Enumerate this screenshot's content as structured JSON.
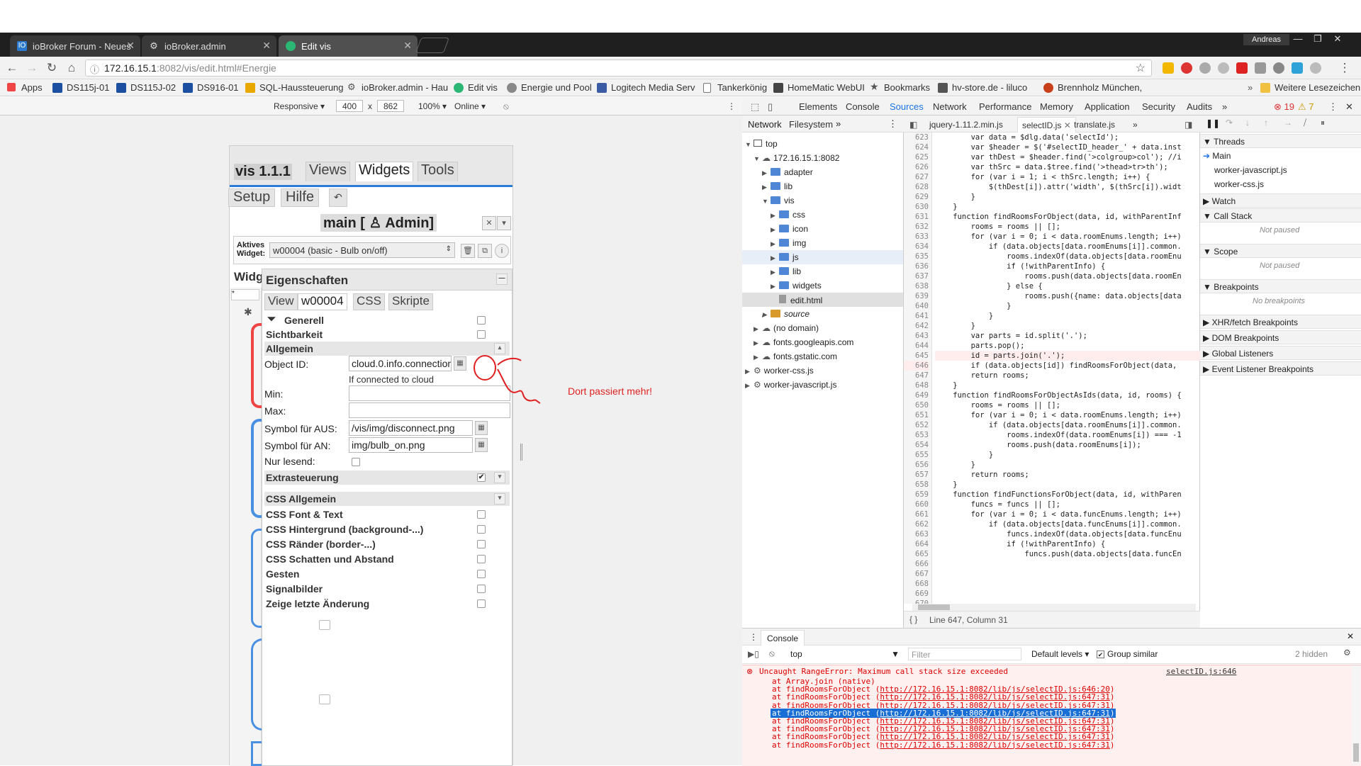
{
  "browser": {
    "tabs": [
      {
        "label": "ioBroker Forum - Neues"
      },
      {
        "label": "ioBroker.admin"
      },
      {
        "label": "Edit vis"
      }
    ],
    "user": "Andreas",
    "url_host": "172.16.15.1",
    "url_rest": ":8082/vis/edit.html#Energie",
    "bookmarks": [
      {
        "label": "Apps"
      },
      {
        "label": "DS115j-01"
      },
      {
        "label": "DS115J-02"
      },
      {
        "label": "DS916-01"
      },
      {
        "label": "SQL-Haussteuerung"
      },
      {
        "label": "ioBroker.admin - Hau"
      },
      {
        "label": "Edit vis"
      },
      {
        "label": "Energie und Pool"
      },
      {
        "label": "Logitech Media Serv"
      },
      {
        "label": "Tankerkönig"
      },
      {
        "label": "HomeMatic WebUI"
      },
      {
        "label": "Bookmarks"
      },
      {
        "label": "hv-store.de - liluco"
      },
      {
        "label": "Brennholz München,"
      }
    ],
    "other_bookmarks": "Weitere Lesezeichen"
  },
  "device_toolbar": {
    "mode": "Responsive",
    "width": "400",
    "times": "x",
    "height": "862",
    "zoom": "100%",
    "network": "Online"
  },
  "vis": {
    "title": "vis 1.1.1",
    "tabs": [
      "Views",
      "Widgets",
      "Tools"
    ],
    "buttons": [
      "Setup",
      "Hilfe",
      "↶"
    ],
    "main_label": "main [ ♙ Admin]",
    "active_widget_label": "Aktives Widget:",
    "active_widget_value": "w00004 (basic - Bulb on/off)",
    "widg_label": "Widg",
    "properties": {
      "header": "Eigenschaften",
      "tabs": [
        "View",
        "w00004",
        "CSS",
        "Skripte"
      ],
      "sections_top": [
        "Generell",
        "Sichtbarkeit",
        "Allgemein"
      ],
      "object_id_label": "Object ID:",
      "object_id_value": "cloud.0.info.connection",
      "object_id_hint": "If connected to cloud",
      "min_label": "Min:",
      "max_label": "Max:",
      "sym_aus_label": "Symbol für AUS:",
      "sym_aus_value": "/vis/img/disconnect.png",
      "sym_an_label": "Symbol für AN:",
      "sym_an_value": "img/bulb_on.png",
      "readonly_label": "Nur lesend:",
      "extra_label": "Extrasteuerung",
      "css_sections": [
        "CSS Allgemein",
        "CSS Font & Text",
        "CSS Hintergrund (background-...)",
        "CSS Ränder (border-...)",
        "CSS Schatten und Abstand",
        "Gesten",
        "Signalbilder",
        "Zeige letzte Änderung"
      ]
    }
  },
  "annotation": "Dort passiert mehr!",
  "devtools": {
    "tabs": [
      "Elements",
      "Console",
      "Sources",
      "Network",
      "Performance",
      "Memory",
      "Application",
      "Security",
      "Audits"
    ],
    "active_tab": "Sources",
    "error_count": "19",
    "warn_count": "7",
    "nav_tabs": [
      "Network",
      "Filesystem"
    ],
    "tree": [
      "top",
      "172.16.15.1:8082",
      "adapter",
      "lib",
      "vis",
      "css",
      "icon",
      "img",
      "js",
      "lib",
      "widgets",
      "edit.html",
      "source",
      "(no domain)",
      "fonts.googleapis.com",
      "fonts.gstatic.com",
      "worker-css.js",
      "worker-javascript.js"
    ],
    "file_tabs": [
      "jquery-1.11.2.min.js",
      "selectID.js",
      "translate.js"
    ],
    "line_numbers": [
      "623",
      "624",
      "625",
      "626",
      "627",
      "628",
      "629",
      "630",
      "631",
      "632",
      "633",
      "634",
      "635",
      "636",
      "637",
      "638",
      "639",
      "640",
      "641",
      "642",
      "643",
      "644",
      "645",
      "646",
      "647",
      "648",
      "649",
      "650",
      "651",
      "652",
      "653",
      "654",
      "655",
      "656",
      "657",
      "658",
      "659",
      "660",
      "661",
      "662",
      "663",
      "664",
      "665",
      "666",
      "667",
      "668",
      "669",
      "670"
    ],
    "code_lines": [
      "        var data = $dlg.data('selectId');",
      "        var $header = $('#selectID_header_' + data.inst",
      "        var thDest = $header.find('>colgroup>col'); //i",
      "        var thSrc = data.$tree.find('>thead>tr>th');",
      "        for (var i = 1; i < thSrc.length; i++) {",
      "            $(thDest[i]).attr('width', $(thSrc[i]).widt",
      "        }",
      "    }",
      "",
      "    function findRoomsForObject(data, id, withParentInf",
      "        rooms = rooms || [];",
      "        for (var i = 0; i < data.roomEnums.length; i++)",
      "            if (data.objects[data.roomEnums[i]].common.",
      "                rooms.indexOf(data.objects[data.roomEnu",
      "                if (!withParentInfo) {",
      "                    rooms.push(data.objects[data.roomEn",
      "                } else {",
      "                    rooms.push({name: data.objects[data",
      "                }",
      "            }",
      "        }",
      "        var parts = id.split('.');",
      "        parts.pop();",
      "        id = parts.join('.');",
      "        if (data.objects[id]) findRoomsForObject(data,",
      "",
      "        return rooms;",
      "    }",
      "",
      "    function findRoomsForObjectAsIds(data, id, rooms) {",
      "        rooms = rooms || [];",
      "        for (var i = 0; i < data.roomEnums.length; i++)",
      "            if (data.objects[data.roomEnums[i]].common.",
      "                rooms.indexOf(data.roomEnums[i]) === -1",
      "                rooms.push(data.roomEnums[i]);",
      "            }",
      "        }",
      "        return rooms;",
      "    }",
      "",
      "    function findFunctionsForObject(data, id, withParen",
      "        funcs = funcs || [];",
      "        for (var i = 0; i < data.funcEnums.length; i++)",
      "            if (data.objects[data.funcEnums[i]].common.",
      "                funcs.indexOf(data.objects[data.funcEnu",
      "                if (!withParentInfo) {",
      "                    funcs.push(data.objects[data.funcEn",
      ""
    ],
    "status": "Line 647, Column 31",
    "debugger": {
      "threads": "Threads",
      "main": "Main",
      "worker_js": "worker-javascript.js",
      "worker_css": "worker-css.js",
      "watch": "Watch",
      "call_stack": "Call Stack",
      "not_paused": "Not paused",
      "scope": "Scope",
      "breakpoints": "Breakpoints",
      "no_breakpoints": "No breakpoints",
      "xhr": "XHR/fetch Breakpoints",
      "dom": "DOM Breakpoints",
      "global": "Global Listeners",
      "event": "Event Listener Breakpoints"
    }
  },
  "console": {
    "title": "Console",
    "context": "top",
    "filter_placeholder": "Filter",
    "levels": "Default levels",
    "group_similar": "Group similar",
    "hidden": "2 hidden",
    "error_message": "Uncaught RangeError: Maximum call stack size exceeded",
    "error_source": "selectID.js:646",
    "stack": [
      {
        "prefix": "at Array.join (native)",
        "link": ""
      },
      {
        "prefix": "at findRoomsForObject (",
        "link": "http://172.16.15.1:8082/lib/js/selectID.js:646:20",
        "suffix": ")"
      },
      {
        "prefix": "at findRoomsForObject (",
        "link": "http://172.16.15.1:8082/lib/js/selectID.js:647:31",
        "suffix": ")"
      },
      {
        "prefix": "at findRoomsForObject (",
        "link": "http://172.16.15.1:8082/lib/js/selectID.js:647:31",
        "suffix": ")"
      },
      {
        "prefix": "at findRoomsForObject (",
        "link": "http://172.16.15.1:8082/lib/js/selectID.js:647:31",
        "suffix": ")"
      },
      {
        "prefix": "at findRoomsForObject (",
        "link": "http://172.16.15.1:8082/lib/js/selectID.js:647:31",
        "suffix": ")"
      },
      {
        "prefix": "at findRoomsForObject (",
        "link": "http://172.16.15.1:8082/lib/js/selectID.js:647:31",
        "suffix": ")"
      },
      {
        "prefix": "at findRoomsForObject (",
        "link": "http://172.16.15.1:8082/lib/js/selectID.js:647:31",
        "suffix": ")"
      },
      {
        "prefix": "at findRoomsForObject (",
        "link": "http://172.16.15.1:8082/lib/js/selectID.js:647:31",
        "suffix": ")"
      }
    ]
  }
}
